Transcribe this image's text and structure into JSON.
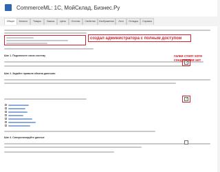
{
  "window": {
    "title": "CommerceML: 1С, МойСклад, Бизнес.Ру"
  },
  "tabs": [
    {
      "label": "Общее",
      "active": true
    },
    {
      "label": "Каталог",
      "active": false
    },
    {
      "label": "Товары",
      "active": false
    },
    {
      "label": "Заказы",
      "active": false
    },
    {
      "label": "Цены",
      "active": false
    },
    {
      "label": "Остатки",
      "active": false
    },
    {
      "label": "Свойства",
      "active": false
    },
    {
      "label": "Изображения",
      "active": false
    },
    {
      "label": "Логи",
      "active": false
    },
    {
      "label": "Отладка",
      "active": false
    },
    {
      "label": "Справка",
      "active": false
    }
  ],
  "annotations": {
    "admin_note": "создал администратора с полным доступом",
    "checkboxes_note_line1": "галки стоят хотя",
    "checkboxes_note_line2": "соединения нет"
  },
  "sections": {
    "step1_title": "Шаг 1. Подключите свою систему",
    "step2_title": "Шаг 2. Задайте правила обмена данными",
    "step3_title": "Шаг 3. Синхронизируйте данные"
  },
  "colors": {
    "accent_red": "#d0232f",
    "brand_blue": "#2f66b2"
  }
}
